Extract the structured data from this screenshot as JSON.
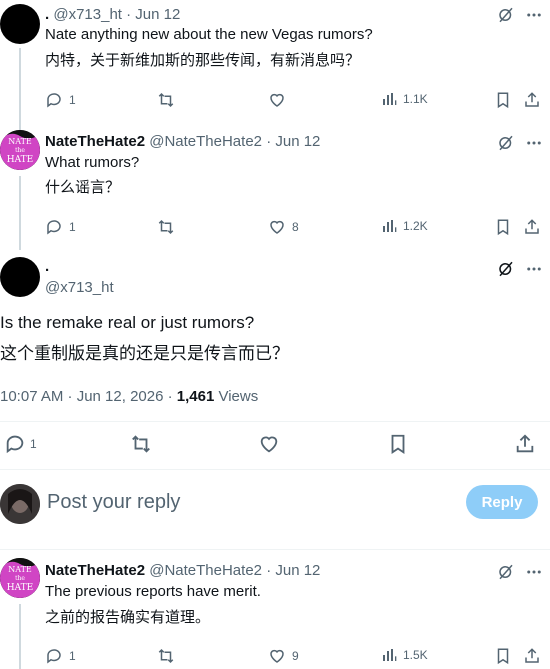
{
  "tweets": [
    {
      "name": ".",
      "handle": "@x713_ht",
      "date": "Jun 12",
      "text_en": "Nate anything new about the new Vegas rumors?",
      "text_zh": "内特，关于新维加斯的那些传闻，有新消息吗？",
      "replies": "1",
      "likes": "",
      "views": "1.1K"
    },
    {
      "name": "NateTheHate2",
      "handle": "@NateTheHate2",
      "date": "Jun 12",
      "text_en": "What rumors?",
      "text_zh": "什么谣言？",
      "replies": "1",
      "likes": "8",
      "views": "1.2K"
    }
  ],
  "main": {
    "name": ".",
    "handle": "@x713_ht",
    "text_en": "Is the remake real or just rumors?",
    "text_zh": "这个重制版是真的还是只是传言而已？",
    "time": "10:07 AM · Jun 12, 2026 · ",
    "views_count": "1,461",
    "views_label": " Views",
    "replies": "1"
  },
  "reply_box": {
    "placeholder": "Post your reply",
    "button": "Reply"
  },
  "reply": {
    "name": "NateTheHate2",
    "handle": "@NateTheHate2",
    "date": "Jun 12",
    "text_en": "The previous reports have merit.",
    "text_zh": "之前的报告确实有道理。",
    "replies": "1",
    "likes": "9",
    "views": "1.5K"
  },
  "avatar_text": [
    "NATE",
    "the",
    "HATE"
  ],
  "colors": {
    "text": "#0f1419",
    "muted": "#536471",
    "divider": "#eff3f4",
    "reply_button": "#8ecdf8",
    "avatar_pink": "#e64bd8"
  },
  "icons": [
    "grok-icon",
    "more-icon",
    "reply-icon",
    "retweet-icon",
    "like-icon",
    "views-icon",
    "bookmark-icon",
    "share-icon"
  ]
}
